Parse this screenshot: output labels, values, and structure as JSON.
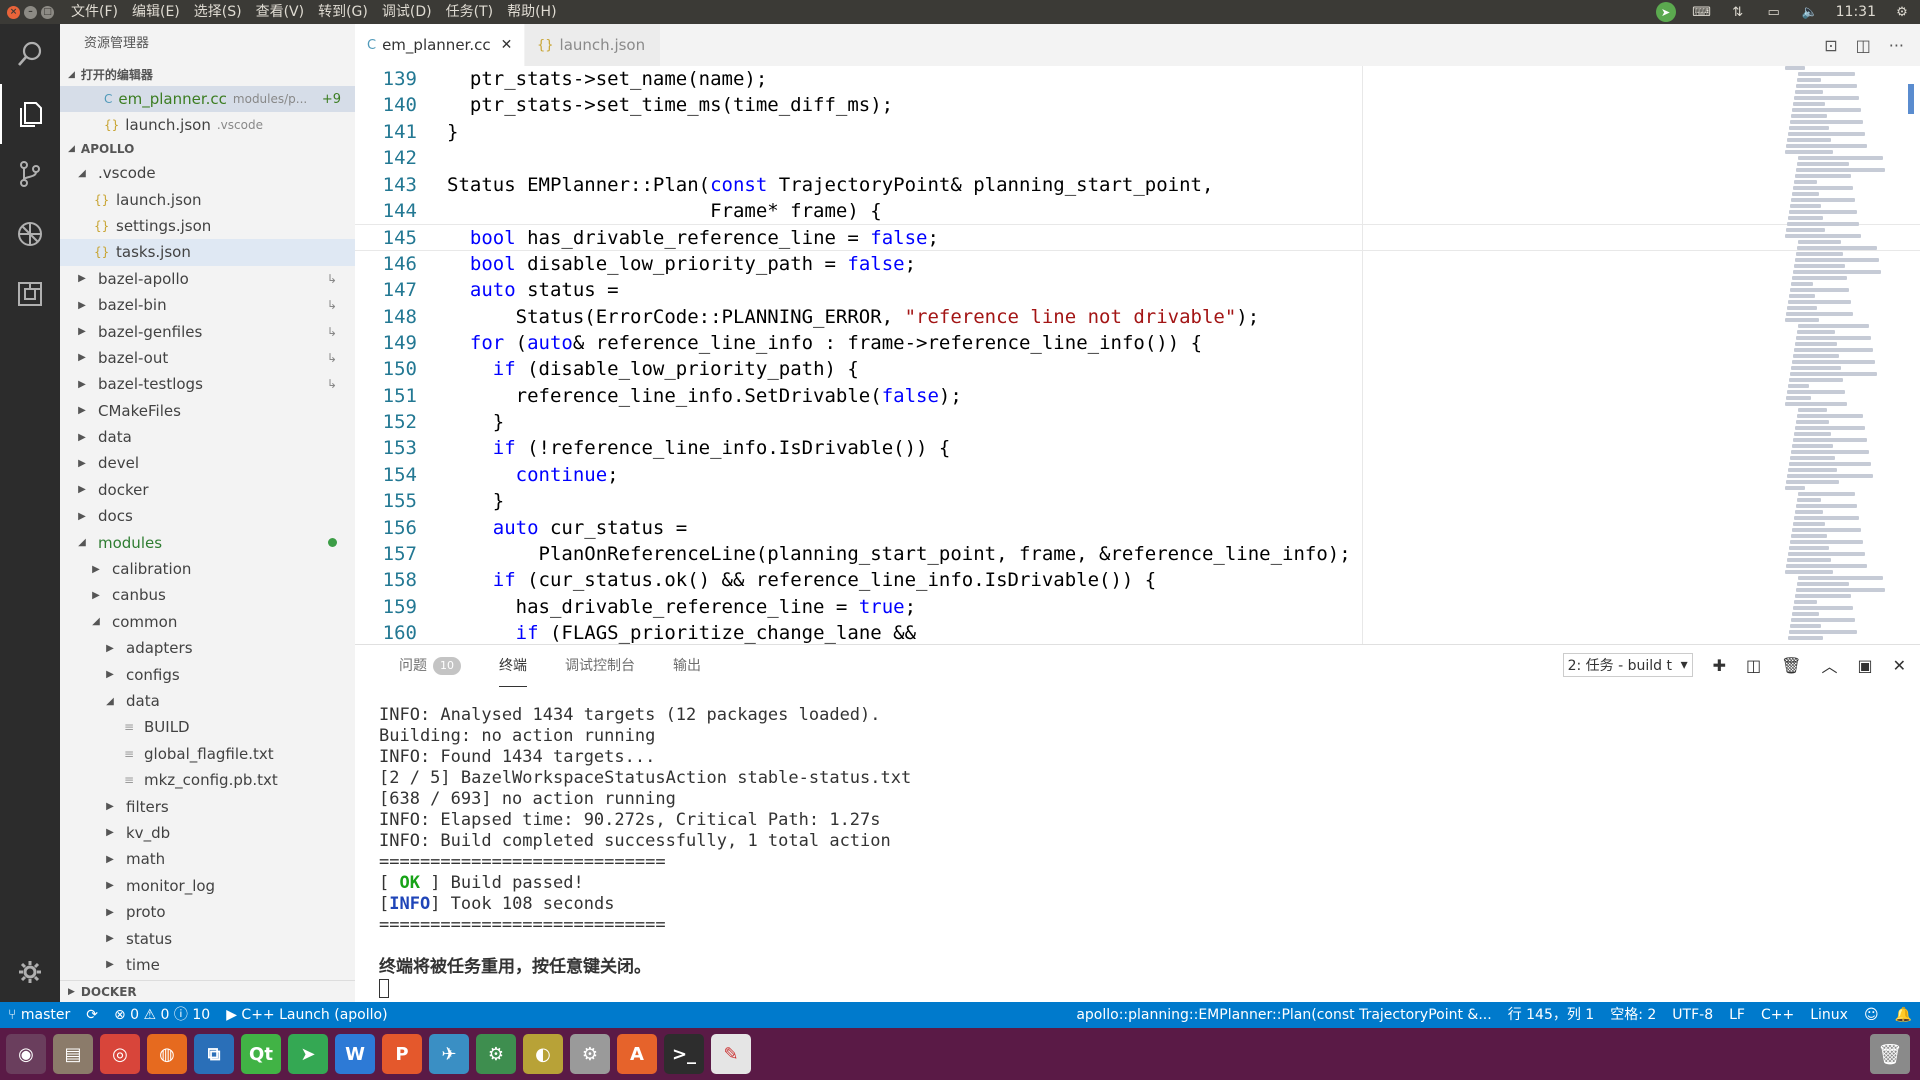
{
  "menubar": [
    "文件(F)",
    "编辑(E)",
    "选择(S)",
    "查看(V)",
    "转到(G)",
    "调试(D)",
    "任务(T)",
    "帮助(H)"
  ],
  "tray": {
    "time": "11:31"
  },
  "sidebar": {
    "title": "资源管理器",
    "open_editors_label": "打开的编辑器",
    "open_editors": [
      {
        "name": "em_planner.cc",
        "path": "modules/p...",
        "badge": "+9",
        "icon": "C"
      },
      {
        "name": "launch.json",
        "path": ".vscode",
        "icon": "{}"
      }
    ],
    "project_label": "APOLLO",
    "tree": [
      {
        "label": ".vscode",
        "depth": 1,
        "kind": "folder",
        "open": true
      },
      {
        "label": "launch.json",
        "depth": 2,
        "kind": "json"
      },
      {
        "label": "settings.json",
        "depth": 2,
        "kind": "json"
      },
      {
        "label": "tasks.json",
        "depth": 2,
        "kind": "json",
        "selected": true
      },
      {
        "label": "bazel-apollo",
        "depth": 1,
        "kind": "folder",
        "link": true
      },
      {
        "label": "bazel-bin",
        "depth": 1,
        "kind": "folder",
        "link": true
      },
      {
        "label": "bazel-genfiles",
        "depth": 1,
        "kind": "folder",
        "link": true
      },
      {
        "label": "bazel-out",
        "depth": 1,
        "kind": "folder",
        "link": true
      },
      {
        "label": "bazel-testlogs",
        "depth": 1,
        "kind": "folder",
        "link": true
      },
      {
        "label": "CMakeFiles",
        "depth": 1,
        "kind": "folder"
      },
      {
        "label": "data",
        "depth": 1,
        "kind": "folder"
      },
      {
        "label": "devel",
        "depth": 1,
        "kind": "folder"
      },
      {
        "label": "docker",
        "depth": 1,
        "kind": "folder"
      },
      {
        "label": "docs",
        "depth": 1,
        "kind": "folder"
      },
      {
        "label": "modules",
        "depth": 1,
        "kind": "folder",
        "open": true,
        "modified": true
      },
      {
        "label": "calibration",
        "depth": 2,
        "kind": "folder"
      },
      {
        "label": "canbus",
        "depth": 2,
        "kind": "folder"
      },
      {
        "label": "common",
        "depth": 2,
        "kind": "folder",
        "open": true
      },
      {
        "label": "adapters",
        "depth": 3,
        "kind": "folder"
      },
      {
        "label": "configs",
        "depth": 3,
        "kind": "folder"
      },
      {
        "label": "data",
        "depth": 3,
        "kind": "folder",
        "open": true
      },
      {
        "label": "BUILD",
        "depth": 4,
        "kind": "txt"
      },
      {
        "label": "global_flagfile.txt",
        "depth": 4,
        "kind": "txt"
      },
      {
        "label": "mkz_config.pb.txt",
        "depth": 4,
        "kind": "txt"
      },
      {
        "label": "filters",
        "depth": 3,
        "kind": "folder"
      },
      {
        "label": "kv_db",
        "depth": 3,
        "kind": "folder"
      },
      {
        "label": "math",
        "depth": 3,
        "kind": "folder"
      },
      {
        "label": "monitor_log",
        "depth": 3,
        "kind": "folder"
      },
      {
        "label": "proto",
        "depth": 3,
        "kind": "folder"
      },
      {
        "label": "status",
        "depth": 3,
        "kind": "folder"
      },
      {
        "label": "time",
        "depth": 3,
        "kind": "folder"
      }
    ],
    "docker_label": "DOCKER"
  },
  "tabs": [
    {
      "label": "em_planner.cc",
      "active": true,
      "icon": "C"
    },
    {
      "label": "launch.json",
      "active": false,
      "icon": "{}"
    }
  ],
  "editor": {
    "current_line": 145,
    "lines": [
      {
        "n": "139",
        "segs": [
          [
            "  ptr_stats->set_name(name);",
            ""
          ]
        ]
      },
      {
        "n": "140",
        "segs": [
          [
            "  ptr_stats->set_time_ms(time_diff_ms);",
            ""
          ]
        ]
      },
      {
        "n": "141",
        "segs": [
          [
            "}",
            ""
          ]
        ]
      },
      {
        "n": "142",
        "segs": [
          [
            "",
            ""
          ]
        ]
      },
      {
        "n": "143",
        "segs": [
          [
            "Status EMPlanner::Plan(",
            ""
          ],
          [
            "const",
            "kw"
          ],
          [
            " TrajectoryPoint& planning_start_point,",
            ""
          ]
        ]
      },
      {
        "n": "144",
        "segs": [
          [
            "                       Frame* frame) {",
            ""
          ]
        ]
      },
      {
        "n": "145",
        "segs": [
          [
            "  ",
            ""
          ],
          [
            "bool",
            "kw"
          ],
          [
            " has_drivable_reference_line = ",
            ""
          ],
          [
            "false",
            "kw"
          ],
          [
            ";",
            ""
          ]
        ]
      },
      {
        "n": "146",
        "segs": [
          [
            "  ",
            ""
          ],
          [
            "bool",
            "kw"
          ],
          [
            " disable_low_priority_path = ",
            ""
          ],
          [
            "false",
            "kw"
          ],
          [
            ";",
            ""
          ]
        ]
      },
      {
        "n": "147",
        "segs": [
          [
            "  ",
            ""
          ],
          [
            "auto",
            "kw"
          ],
          [
            " status =",
            ""
          ]
        ]
      },
      {
        "n": "148",
        "segs": [
          [
            "      Status(ErrorCode::PLANNING_ERROR, ",
            ""
          ],
          [
            "\"reference line not drivable\"",
            "str"
          ],
          [
            ");",
            ""
          ]
        ]
      },
      {
        "n": "149",
        "segs": [
          [
            "  ",
            ""
          ],
          [
            "for",
            "kw"
          ],
          [
            " (",
            ""
          ],
          [
            "auto",
            "kw"
          ],
          [
            "& reference_line_info : frame->reference_line_info()) {",
            ""
          ]
        ]
      },
      {
        "n": "150",
        "segs": [
          [
            "    ",
            ""
          ],
          [
            "if",
            "kw"
          ],
          [
            " (disable_low_priority_path) {",
            ""
          ]
        ]
      },
      {
        "n": "151",
        "segs": [
          [
            "      reference_line_info.SetDrivable(",
            ""
          ],
          [
            "false",
            "kw"
          ],
          [
            ");",
            ""
          ]
        ]
      },
      {
        "n": "152",
        "segs": [
          [
            "    }",
            ""
          ]
        ]
      },
      {
        "n": "153",
        "segs": [
          [
            "    ",
            ""
          ],
          [
            "if",
            "kw"
          ],
          [
            " (!reference_line_info.IsDrivable()) {",
            ""
          ]
        ]
      },
      {
        "n": "154",
        "segs": [
          [
            "      ",
            ""
          ],
          [
            "continue",
            "kw"
          ],
          [
            ";",
            ""
          ]
        ]
      },
      {
        "n": "155",
        "segs": [
          [
            "    }",
            ""
          ]
        ]
      },
      {
        "n": "156",
        "segs": [
          [
            "    ",
            ""
          ],
          [
            "auto",
            "kw"
          ],
          [
            " cur_status =",
            ""
          ]
        ]
      },
      {
        "n": "157",
        "segs": [
          [
            "        PlanOnReferenceLine(planning_start_point, frame, &reference_line_info);",
            ""
          ]
        ]
      },
      {
        "n": "158",
        "segs": [
          [
            "    ",
            ""
          ],
          [
            "if",
            "kw"
          ],
          [
            " (cur_status.ok() && reference_line_info.IsDrivable()) {",
            ""
          ]
        ]
      },
      {
        "n": "159",
        "segs": [
          [
            "      has_drivable_reference_line = ",
            ""
          ],
          [
            "true",
            "kw"
          ],
          [
            ";",
            ""
          ]
        ]
      },
      {
        "n": "160",
        "segs": [
          [
            "      ",
            ""
          ],
          [
            "if",
            "kw"
          ],
          [
            " (FLAGS_prioritize_change_lane &&",
            ""
          ]
        ]
      }
    ]
  },
  "panel": {
    "tabs": [
      {
        "label": "问题",
        "badge": "10"
      },
      {
        "label": "终端",
        "active": true
      },
      {
        "label": "调试控制台"
      },
      {
        "label": "输出"
      }
    ],
    "task_select": "2: 任务 - build t",
    "terminal": [
      {
        "segs": [
          [
            "INFO: Analysed 1434 targets (12 packages loaded).",
            ""
          ]
        ]
      },
      {
        "segs": [
          [
            "Building: no action running",
            ""
          ]
        ]
      },
      {
        "segs": [
          [
            "INFO: Found 1434 targets...",
            ""
          ]
        ]
      },
      {
        "segs": [
          [
            "[2 / 5] BazelWorkspaceStatusAction stable-status.txt",
            ""
          ]
        ]
      },
      {
        "segs": [
          [
            "[638 / 693] no action running",
            ""
          ]
        ]
      },
      {
        "segs": [
          [
            "INFO: Elapsed time: 90.272s, Critical Path: 1.27s",
            ""
          ]
        ]
      },
      {
        "segs": [
          [
            "INFO: Build completed successfully, 1 total action",
            ""
          ]
        ]
      },
      {
        "segs": [
          [
            "============================",
            ""
          ]
        ]
      },
      {
        "segs": [
          [
            "[ ",
            ""
          ],
          [
            "OK",
            "ok"
          ],
          [
            " ] Build passed!",
            ""
          ]
        ]
      },
      {
        "segs": [
          [
            "[",
            ""
          ],
          [
            "INFO",
            "info"
          ],
          [
            "] Took 108 seconds",
            ""
          ]
        ]
      },
      {
        "segs": [
          [
            "============================",
            ""
          ]
        ]
      },
      {
        "segs": [
          [
            "",
            ""
          ]
        ]
      },
      {
        "segs": [
          [
            "终端将被任务重用，按任意键关闭。",
            "bold"
          ]
        ]
      }
    ]
  },
  "statusbar": {
    "branch": "master",
    "errors": "0",
    "warnings": "0",
    "infos": "10",
    "launch": "C++ Launch (apollo)",
    "symbol": "apollo::planning::EMPlanner::Plan(const TrajectoryPoint &...",
    "position": "行 145，列 1",
    "spaces": "空格: 2",
    "encoding": "UTF-8",
    "eol": "LF",
    "language": "C++",
    "os": "Linux"
  },
  "dock": [
    {
      "name": "ubuntu-dash-icon",
      "color": "#6a3e5d"
    },
    {
      "name": "files-icon",
      "color": "#8b7b6a"
    },
    {
      "name": "chrome-icon",
      "color": "#d8453a"
    },
    {
      "name": "firefox-icon",
      "color": "#e66a1f"
    },
    {
      "name": "vscode-icon",
      "color": "#2a6fb8"
    },
    {
      "name": "qtcreator-icon",
      "color": "#41b345"
    },
    {
      "name": "telegram-icon",
      "color": "#34a853"
    },
    {
      "name": "wps-writer-icon",
      "color": "#2d7ad6"
    },
    {
      "name": "wps-presentation-icon",
      "color": "#e4582c"
    },
    {
      "name": "remote-desktop-icon",
      "color": "#3a8fc4"
    },
    {
      "name": "network-tool-icon",
      "color": "#3e8e4f"
    },
    {
      "name": "media-player-icon",
      "color": "#b8a237"
    },
    {
      "name": "system-settings-icon",
      "color": "#9a9a9a"
    },
    {
      "name": "software-center-icon",
      "color": "#e6632b"
    },
    {
      "name": "terminal-icon",
      "color": "#2d2d2d"
    },
    {
      "name": "screenshot-tool-icon",
      "color": "#e5e5e5"
    }
  ]
}
